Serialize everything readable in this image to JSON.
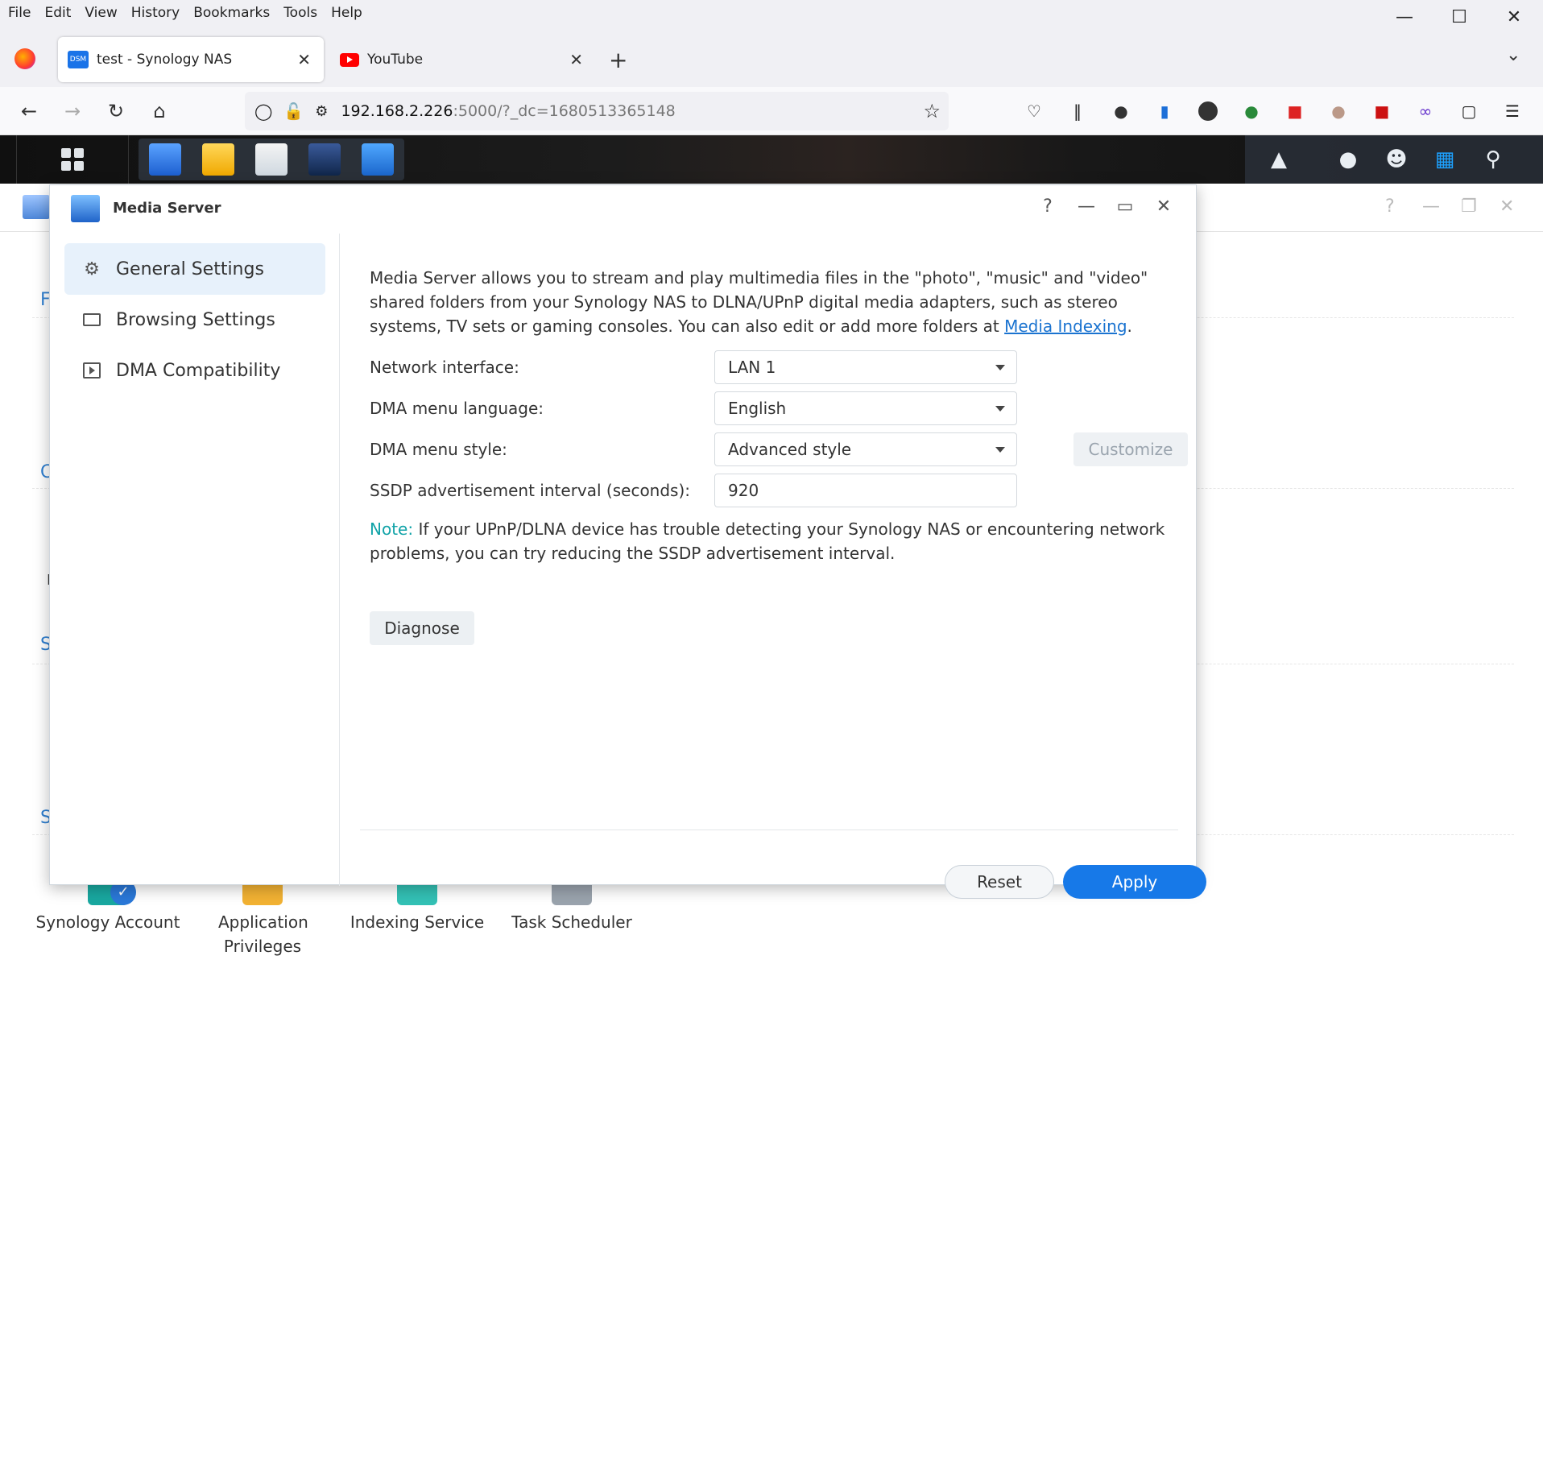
{
  "menubar": {
    "items": [
      "File",
      "Edit",
      "View",
      "History",
      "Bookmarks",
      "Tools",
      "Help"
    ]
  },
  "tabs": [
    {
      "title": "test - Synology NAS",
      "icon": "DSM"
    },
    {
      "title": "YouTube"
    }
  ],
  "address": {
    "host": "192.168.2.226",
    "rest": ":5000/?_dc=1680513365148"
  },
  "bg_apps": [
    {
      "label": "Synology Account"
    },
    {
      "label": "Application Privileges"
    },
    {
      "label": "Indexing Service"
    },
    {
      "label": "Task Scheduler"
    }
  ],
  "bg_letters": [
    "F",
    "C",
    "I",
    "S",
    "S"
  ],
  "modal": {
    "title": "Media Server",
    "sidebar": [
      {
        "label": "General Settings",
        "selected": true
      },
      {
        "label": "Browsing Settings"
      },
      {
        "label": "DMA Compatibility"
      }
    ],
    "description_main": "Media Server allows you to stream and play multimedia files in the \"photo\", \"music\" and \"video\" shared folders from your Synology NAS to DLNA/UPnP digital media adapters, such as stereo systems, TV sets or gaming consoles. You can also edit or add more folders at ",
    "description_link": "Media Indexing",
    "description_end": ".",
    "fields": {
      "network_interface": {
        "label": "Network interface:",
        "value": "LAN 1"
      },
      "menu_language": {
        "label": "DMA menu language:",
        "value": "English"
      },
      "menu_style": {
        "label": "DMA menu style:",
        "value": "Advanced style",
        "customize": "Customize"
      },
      "ssdp": {
        "label": "SSDP advertisement interval (seconds):",
        "value": "920"
      }
    },
    "note_label": "Note:",
    "note_text": " If your UPnP/DLNA device has trouble detecting your Synology NAS or encountering network problems, you can try reducing the SSDP advertisement interval.",
    "diagnose": "Diagnose",
    "reset": "Reset",
    "apply": "Apply"
  },
  "colors": {
    "accent": "#1779e8",
    "note": "#11a3a8",
    "link": "#1a73d0"
  }
}
